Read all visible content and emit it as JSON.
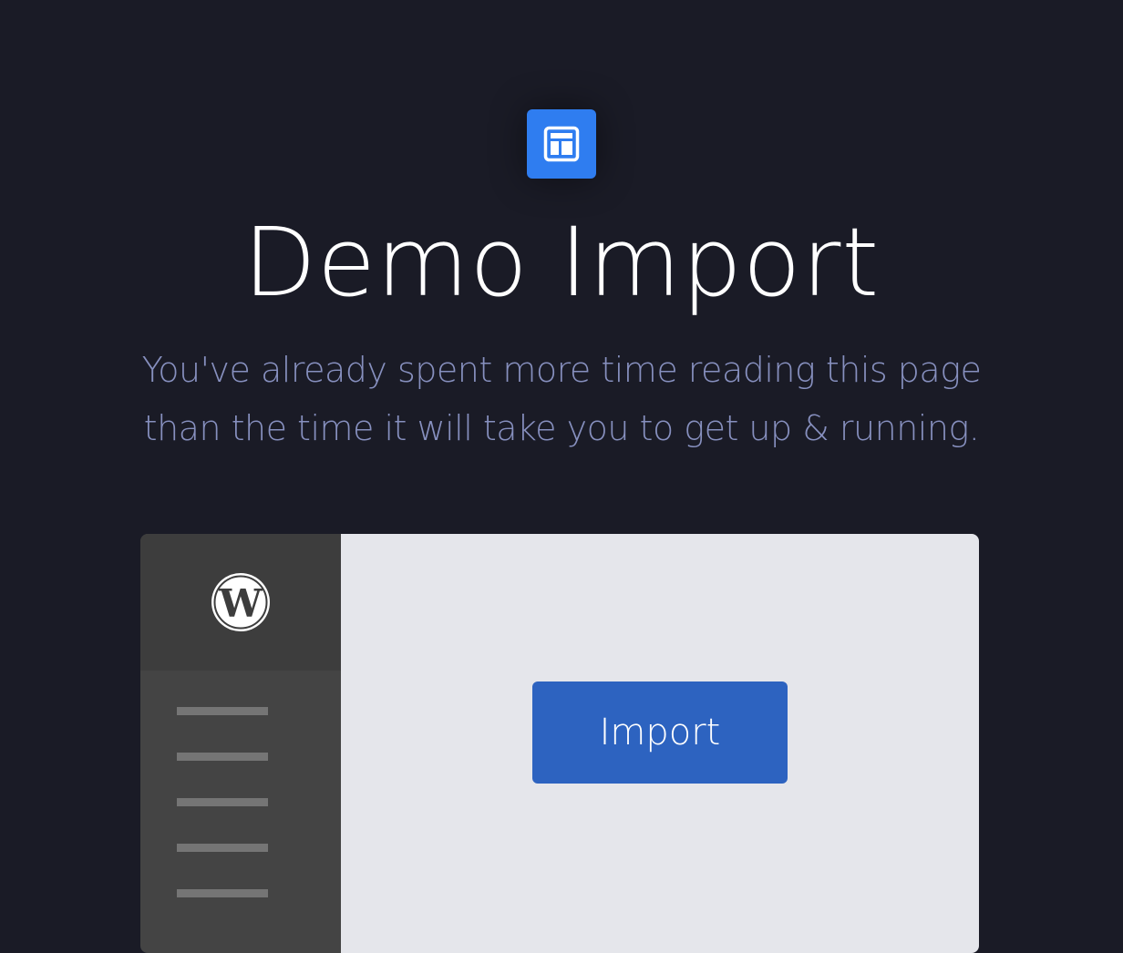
{
  "app_icon": {
    "icon": "layout-template-icon",
    "color": "#2f7df0"
  },
  "header": {
    "title": "Demo Import",
    "subtitle_line1": "You've already spent more time reading this page",
    "subtitle_line2": "than the time it will take you to get up & running."
  },
  "mockup": {
    "sidebar_logo": "wordpress-icon",
    "menu_line_count": 5,
    "import_button": {
      "label": "Import",
      "color": "#2d63c0"
    }
  },
  "colors": {
    "background": "#1a1b26",
    "subtitle": "#8790bf",
    "sidebar": "#444444",
    "content": "#e5e6eb"
  }
}
